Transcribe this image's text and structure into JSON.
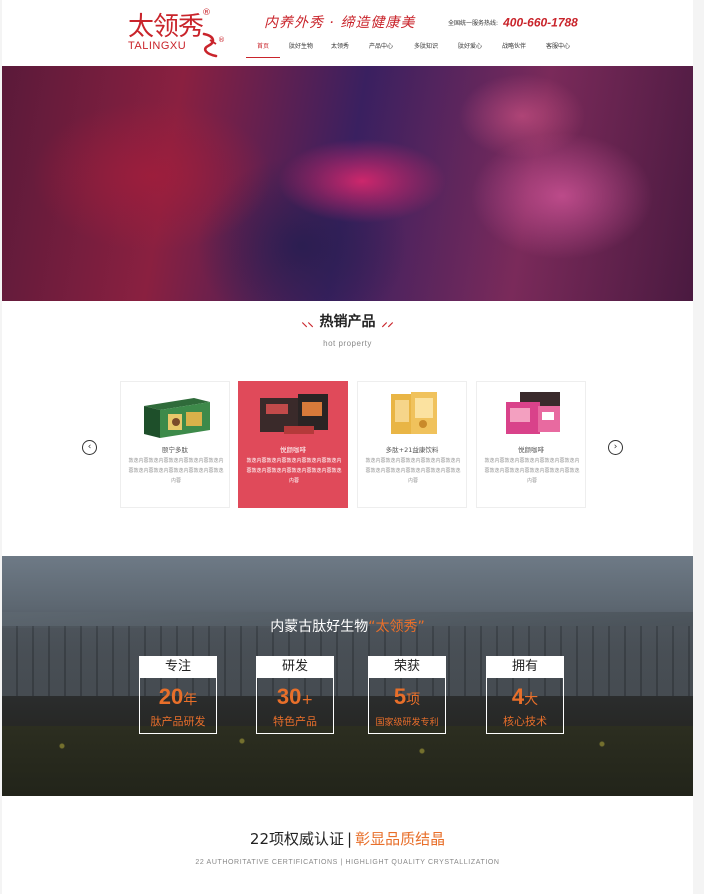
{
  "header": {
    "logo_cn": "太领秀",
    "logo_en": "TALINGXU",
    "logo_reg": "®",
    "slogan": "内养外秀 · 缔造健康美",
    "hotline_label": "全国统一服务热线:",
    "hotline_number": "400-660-1788"
  },
  "nav": {
    "items": [
      {
        "label": "首页",
        "active": true
      },
      {
        "label": "肽好生物",
        "active": false
      },
      {
        "label": "太领秀",
        "active": false
      },
      {
        "label": "产品中心",
        "active": false
      },
      {
        "label": "多肽知识",
        "active": false
      },
      {
        "label": "肽好爱心",
        "active": false
      },
      {
        "label": "战略伙伴",
        "active": false
      },
      {
        "label": "客服中心",
        "active": false
      }
    ]
  },
  "hot": {
    "title": "热销产品",
    "subtitle": "hot property",
    "prev_icon": "‹",
    "next_icon": "›",
    "cards": [
      {
        "name": "颐宁多肽",
        "desc": "敦逸内蓉敦逸内蓉敦逸内蓉敦逸内蓉敦逸内蓉敦逸内蓉敦逸内蓉敦逸内蓉敦逸内蓉敦逸内蓉",
        "active": false
      },
      {
        "name": "悦颜咖啡",
        "desc": "敦逸内蓉敦逸内蓉敦逸内蓉敦逸内蓉敦逸内蓉敦逸内蓉敦逸内蓉敦逸内蓉敦逸内蓉敦逸内蓉",
        "active": true
      },
      {
        "name": "多肽+21益康饮料",
        "desc": "敦逸内蓉敦逸内蓉敦逸内蓉敦逸内蓉敦逸内蓉敦逸内蓉敦逸内蓉敦逸内蓉敦逸内蓉敦逸内蓉",
        "active": false
      },
      {
        "name": "悦颜咖啡",
        "desc": "敦逸内蓉敦逸内蓉敦逸内蓉敦逸内蓉敦逸内蓉敦逸内蓉敦逸内蓉敦逸内蓉敦逸内蓉敦逸内蓉",
        "active": false
      }
    ]
  },
  "company": {
    "title_prefix": "内蒙古肽好生物",
    "title_brand": "“太领秀”",
    "stats": [
      {
        "head": "专注",
        "num": "20",
        "unit": "年",
        "label": "肽产品研发"
      },
      {
        "head": "研发",
        "num": "30",
        "unit": "+",
        "label": "特色产品"
      },
      {
        "head": "荣获",
        "num": "5",
        "unit": "项",
        "label": "国家级研发专利"
      },
      {
        "head": "拥有",
        "num": "4",
        "unit": "大",
        "label": "核心技术"
      }
    ]
  },
  "cert": {
    "title_main": "22项权威认证",
    "separator": "|",
    "title_highlight": "彰显品质结晶",
    "subtitle": "22 AUTHORITATIVE CERTIFICATIONS | HIGHLIGHT QUALITY CRYSTALLIZATION"
  },
  "colors": {
    "brand_red": "#c9242b",
    "card_active": "#e04a5a",
    "accent_orange": "#e86f2a"
  }
}
